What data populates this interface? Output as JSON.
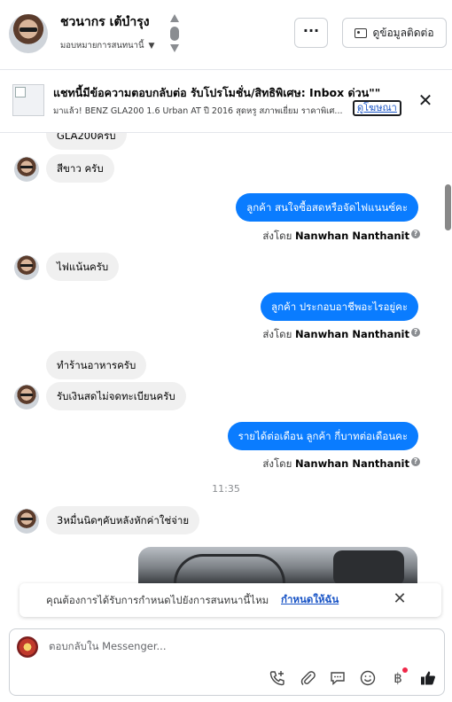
{
  "header": {
    "contact_name": "ชวนากร เต้บำรุง",
    "assign_label": "มอบหมายการสนทนานี้",
    "more_label": "···",
    "contact_info_label": "ดูข้อมูลติดต่อ"
  },
  "banner": {
    "title": "แชทนี้มีข้อความตอบกลับต่อ รับโปรโมชั่น/สิทธิพิเศษ: Inbox ด่วน\"\"",
    "subtitle": "มาแล้ว! BENZ GLA200 1.6 Urban AT ปี 2016 สุดหรู สภาพเยี่ยม ราคาพิเศ...",
    "ad_link": "ดูโฆษณา",
    "close": "✕"
  },
  "messages": [
    {
      "dir": "in",
      "text": "GLA200ครับ"
    },
    {
      "dir": "in",
      "text": "สีขาว ครับ"
    },
    {
      "dir": "out",
      "text": "ลูกค้า สนใจซื้อสดหรือจัดไฟแนนซ์คะ"
    },
    {
      "dir": "meta",
      "prefix": "ส่งโดย",
      "sender": "Nanwhan Nanthanit"
    },
    {
      "dir": "in",
      "text": "ไฟแน้นครับ"
    },
    {
      "dir": "out",
      "text": "ลูกค้า ประกอบอาชีพอะไรอยู่คะ"
    },
    {
      "dir": "meta",
      "prefix": "ส่งโดย",
      "sender": "Nanwhan Nanthanit"
    },
    {
      "dir": "in",
      "text": "ทำร้านอาหารครับ"
    },
    {
      "dir": "in",
      "text": "รับเงินสดไม่จดทะเบียนครับ"
    },
    {
      "dir": "out",
      "text": "รายได้ต่อเดือน ลูกค้า กี่บาทต่อเดือนคะ"
    },
    {
      "dir": "meta",
      "prefix": "ส่งโดย",
      "sender": "Nanwhan Nanthanit"
    },
    {
      "dir": "time",
      "text": "11:35"
    },
    {
      "dir": "in",
      "text": "3หมื่นนิดๆคับหลังหักค่าใช่จ่าย"
    }
  ],
  "suggestion": {
    "text": "คุณต้องการได้รับการกำหนดไปยังการสนทนานี้ไหม",
    "link": "กำหนดให้ฉัน",
    "close": "✕"
  },
  "composer": {
    "placeholder": "ตอบกลับใน Messenger...",
    "value": ""
  },
  "icons": {
    "call_add": "phone-plus-icon",
    "attach": "paperclip-icon",
    "saved_replies": "chat-bubble-icon",
    "emoji": "smiley-icon",
    "payment": "baht-icon",
    "like": "thumbs-up-icon"
  },
  "colors": {
    "outgoing_bubble": "#0a7cff",
    "incoming_bubble": "#f0f0f0",
    "link": "#1a55c6",
    "notification_dot": "#f02849"
  }
}
